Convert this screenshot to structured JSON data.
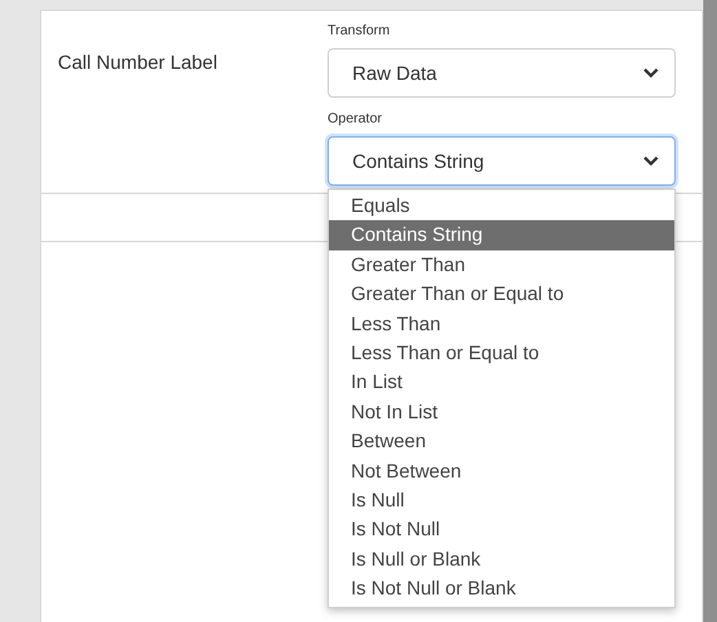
{
  "field": {
    "label": "Call Number Label"
  },
  "transform": {
    "label": "Transform",
    "value": "Raw Data"
  },
  "operator": {
    "label": "Operator",
    "value": "Contains String",
    "focused": true,
    "expanded": true
  },
  "options": [
    {
      "label": "Equals",
      "selected": false
    },
    {
      "label": "Contains String",
      "selected": true
    },
    {
      "label": "Greater Than",
      "selected": false
    },
    {
      "label": "Greater Than or Equal to",
      "selected": false
    },
    {
      "label": "Less Than",
      "selected": false
    },
    {
      "label": "Less Than or Equal to",
      "selected": false
    },
    {
      "label": "In List",
      "selected": false
    },
    {
      "label": "Not In List",
      "selected": false
    },
    {
      "label": "Between",
      "selected": false
    },
    {
      "label": "Not Between",
      "selected": false
    },
    {
      "label": "Is Null",
      "selected": false
    },
    {
      "label": "Is Not Null",
      "selected": false
    },
    {
      "label": "Is Null or Blank",
      "selected": false
    },
    {
      "label": "Is Not Null or Blank",
      "selected": false
    }
  ]
}
